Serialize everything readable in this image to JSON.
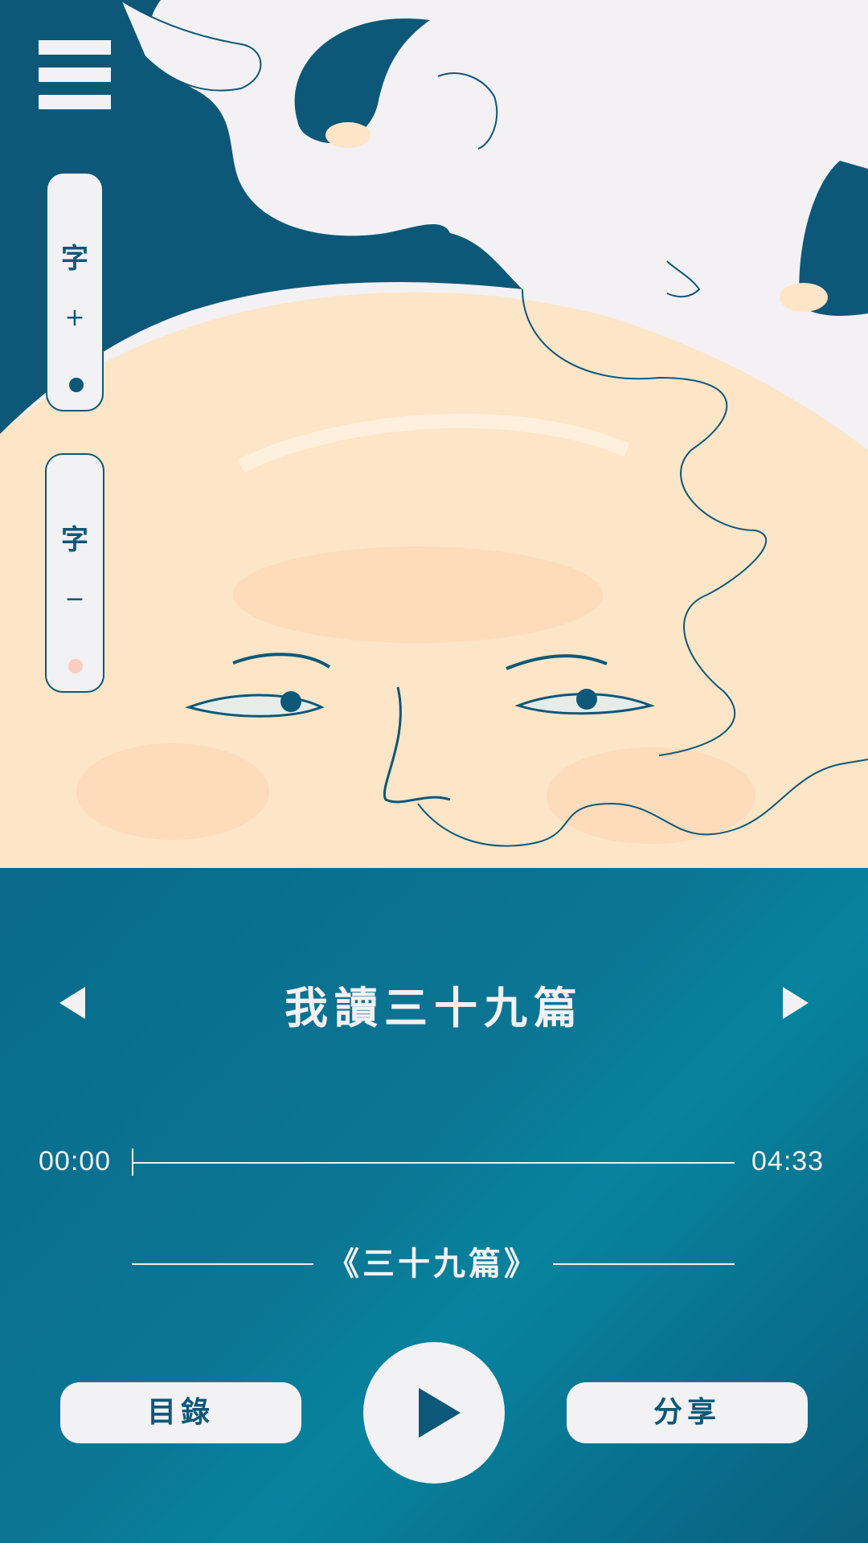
{
  "colors": {
    "dark_teal": "#0d5878",
    "panel_blue": "#0b7694",
    "light": "#f3f1f3",
    "skin": "#fde5c7",
    "dot_active": "#0d5878",
    "dot_inactive": "#f9cdbf"
  },
  "menu": {
    "icon": "hamburger-menu-icon"
  },
  "font_controls": {
    "increase": {
      "char": "字",
      "sign": "+"
    },
    "decrease": {
      "char": "字",
      "sign": "−"
    }
  },
  "player": {
    "title": "我讀三十九篇",
    "prev_icon": "triangle-left-icon",
    "next_icon": "triangle-right-icon",
    "current_time": "00:00",
    "total_time": "04:33",
    "progress": 0,
    "subtitle": "《三十九篇》",
    "toc_label": "目錄",
    "share_label": "分享",
    "play_icon": "play-icon"
  }
}
